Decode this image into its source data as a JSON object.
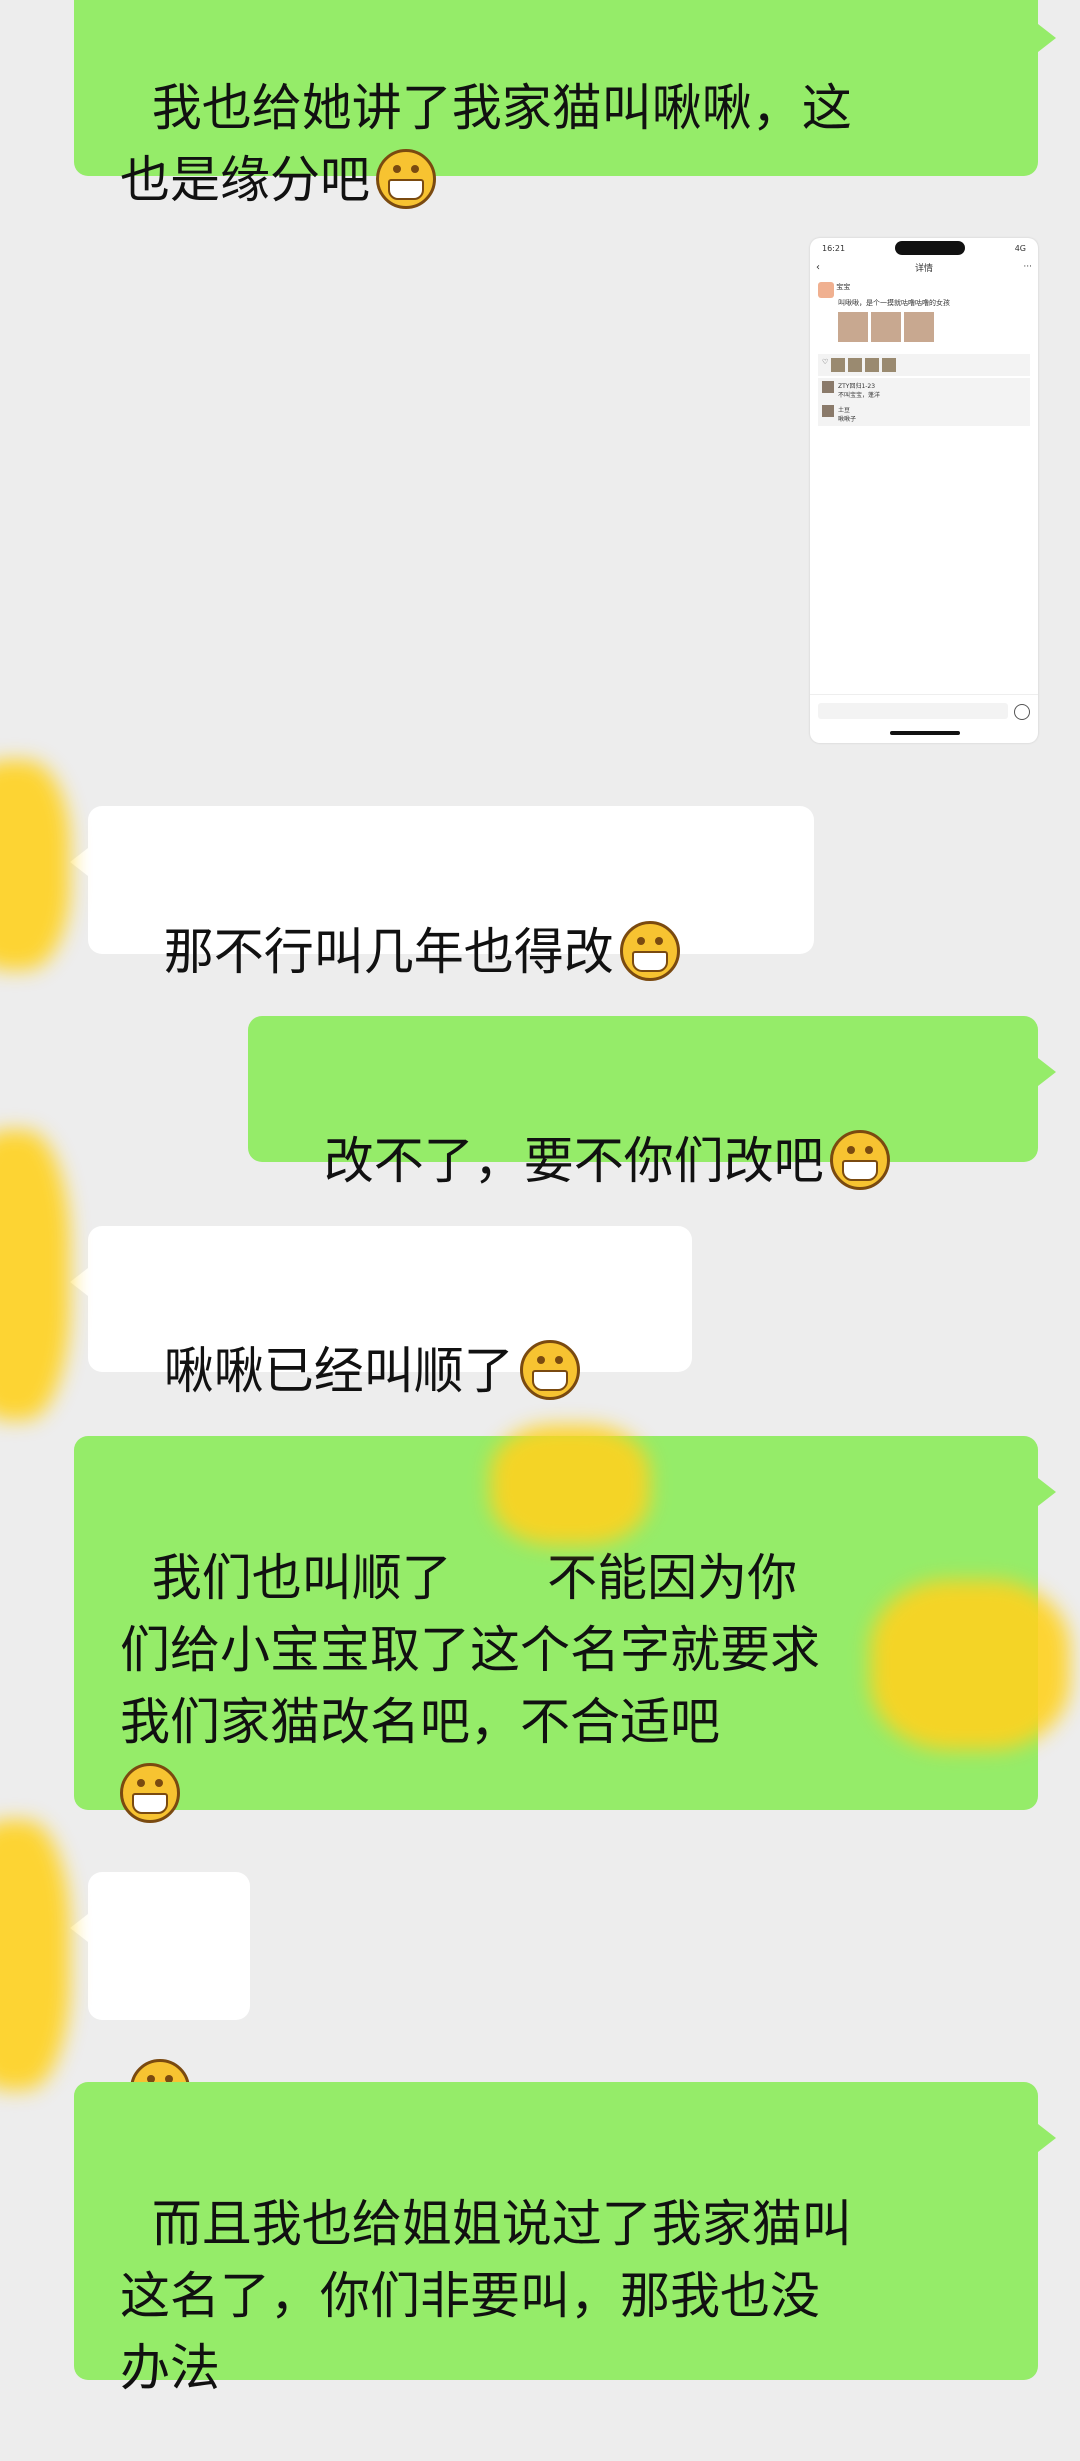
{
  "messages": [
    {
      "side": "right",
      "text": "我也给她讲了我家猫叫啾啾，这\n也是缘分吧"
    },
    {
      "side": "left",
      "text": "那不行叫几年也得改"
    },
    {
      "side": "right",
      "text": "改不了，要不你们改吧"
    },
    {
      "side": "left",
      "text": "啾啾已经叫顺了"
    },
    {
      "side": "right",
      "text": "我们也叫顺了      不能因为你\n们给小宝宝取了这个名字就要求\n我们家猫改名吧，不合适吧"
    },
    {
      "side": "left",
      "text": ""
    },
    {
      "side": "right",
      "text": "而且我也给姐姐说过了我家猫叫\n这名了，你们非要叫，那我也没\n办法"
    }
  ],
  "screenshot": {
    "time": "16:21",
    "signal": "4G",
    "title": "详情",
    "author": "宝宝",
    "caption": "叫啾啾，是个一摸就咕噜咕噜的女孩",
    "comment1_name": "ZTY回归1-23",
    "comment1_text": "不叫宝宝，蓬洋",
    "comment2_name": "土豆",
    "comment2_text": "啾啾子"
  },
  "emoji_name": "grin-emoji",
  "colors": {
    "sent": "#95ec69",
    "received": "#ffffff",
    "background": "#ededed"
  }
}
